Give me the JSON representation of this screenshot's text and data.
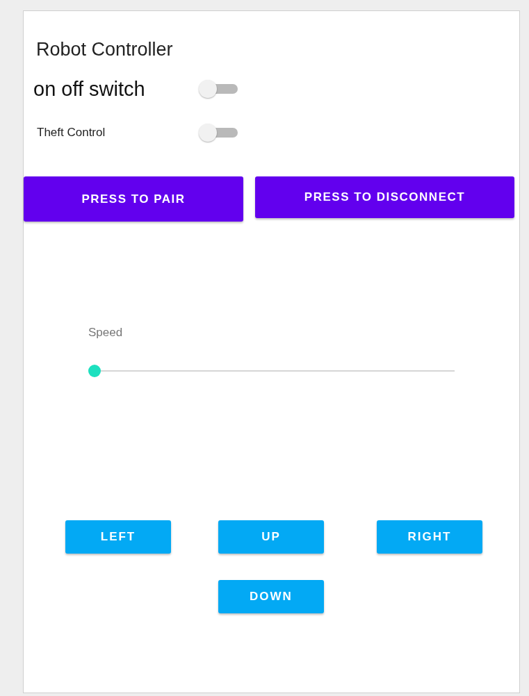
{
  "title": "Robot Controller",
  "switches": [
    {
      "label": "on off switch",
      "kind": "large",
      "on": false
    },
    {
      "label": "Theft Control",
      "kind": "small",
      "on": false
    }
  ],
  "connection_buttons": [
    "PRESS TO PAIR",
    "PRESS TO DISCONNECT"
  ],
  "speed": {
    "label": "Speed",
    "level": 0
  },
  "direction_buttons": [
    "LEFT",
    "UP",
    "RIGHT",
    "DOWN"
  ]
}
